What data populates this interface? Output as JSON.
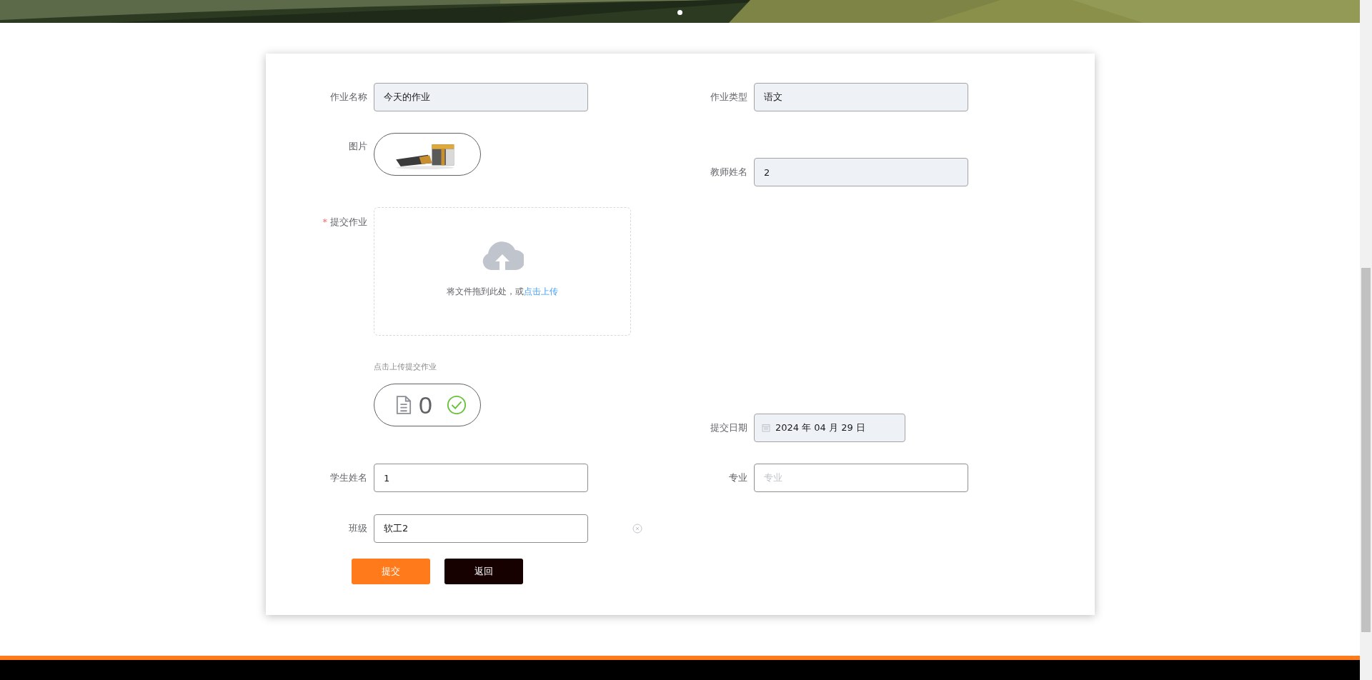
{
  "banner": {
    "kind": "picture",
    "dots": [
      {
        "selected": true
      }
    ]
  },
  "form": {
    "homework_name": {
      "label": "作业名称",
      "value": "今天的作业",
      "disabled": true
    },
    "homework_type": {
      "label": "作业类型",
      "value": "语文",
      "disabled": true
    },
    "image": {
      "label": "图片",
      "kind": "picture"
    },
    "teacher_name": {
      "label": "教师姓名",
      "value": "2",
      "disabled": true
    },
    "submit_homework": {
      "label": "提交作业",
      "required": true,
      "required_mark": "*",
      "upload_text": "将文件拖到此处，或",
      "upload_link": "点击上传",
      "tip": "点击上传提交作业",
      "file_count": "0",
      "uploaded": true
    },
    "submit_date": {
      "label": "提交日期",
      "value": "2024 年 04 月 29 日",
      "disabled": true
    },
    "student_name": {
      "label": "学生姓名",
      "value": "1",
      "disabled": false
    },
    "major": {
      "label": "专业",
      "placeholder": "专业",
      "disabled": false
    },
    "class": {
      "label": "班级",
      "value": "软工2",
      "disabled": false,
      "clearable": true
    },
    "buttons": [
      {
        "label": "提交",
        "kind": "primary"
      },
      {
        "label": "返回",
        "kind": "back"
      }
    ]
  }
}
